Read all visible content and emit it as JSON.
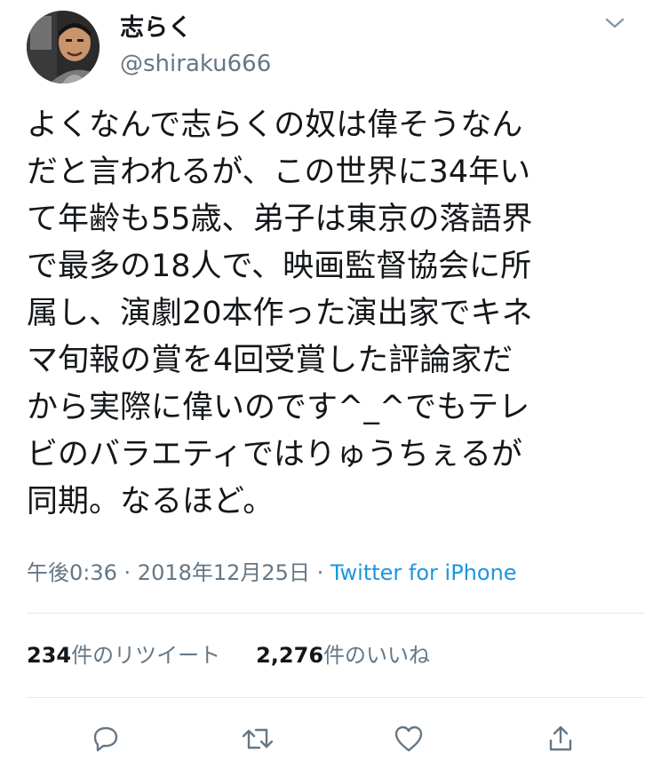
{
  "user": {
    "display_name": "志らく",
    "handle": "@shiraku666"
  },
  "tweet": {
    "text": "よくなんで志らくの奴は偉そうなん\nだと言われるが、この世界に34年い\nて年齢も55歳、弟子は東京の落語界\nで最多の18人で、映画監督協会に所\n属し、演劇20本作った演出家でキネ\nマ旬報の賞を4回受賞した評論家だ\nから実際に偉いのです^_^でもテレ\nビのバラエティではりゅうちぇるが\n同期。なるほど。"
  },
  "meta": {
    "time": "午後0:36",
    "sep1": " · ",
    "date": "2018年12月25日",
    "sep2": " · ",
    "source": "Twitter for iPhone"
  },
  "stats": {
    "retweets_count": "234",
    "retweets_label": "件のリツイート",
    "likes_count": "2,276",
    "likes_label": "件のいいね"
  },
  "colors": {
    "text": "#14171a",
    "secondary": "#657786",
    "link": "#1b95e0",
    "divider": "#e1e8ed"
  },
  "icons": {
    "more": "chevron-down-icon",
    "reply": "reply-icon",
    "retweet": "retweet-icon",
    "like": "heart-icon",
    "share": "share-icon"
  }
}
